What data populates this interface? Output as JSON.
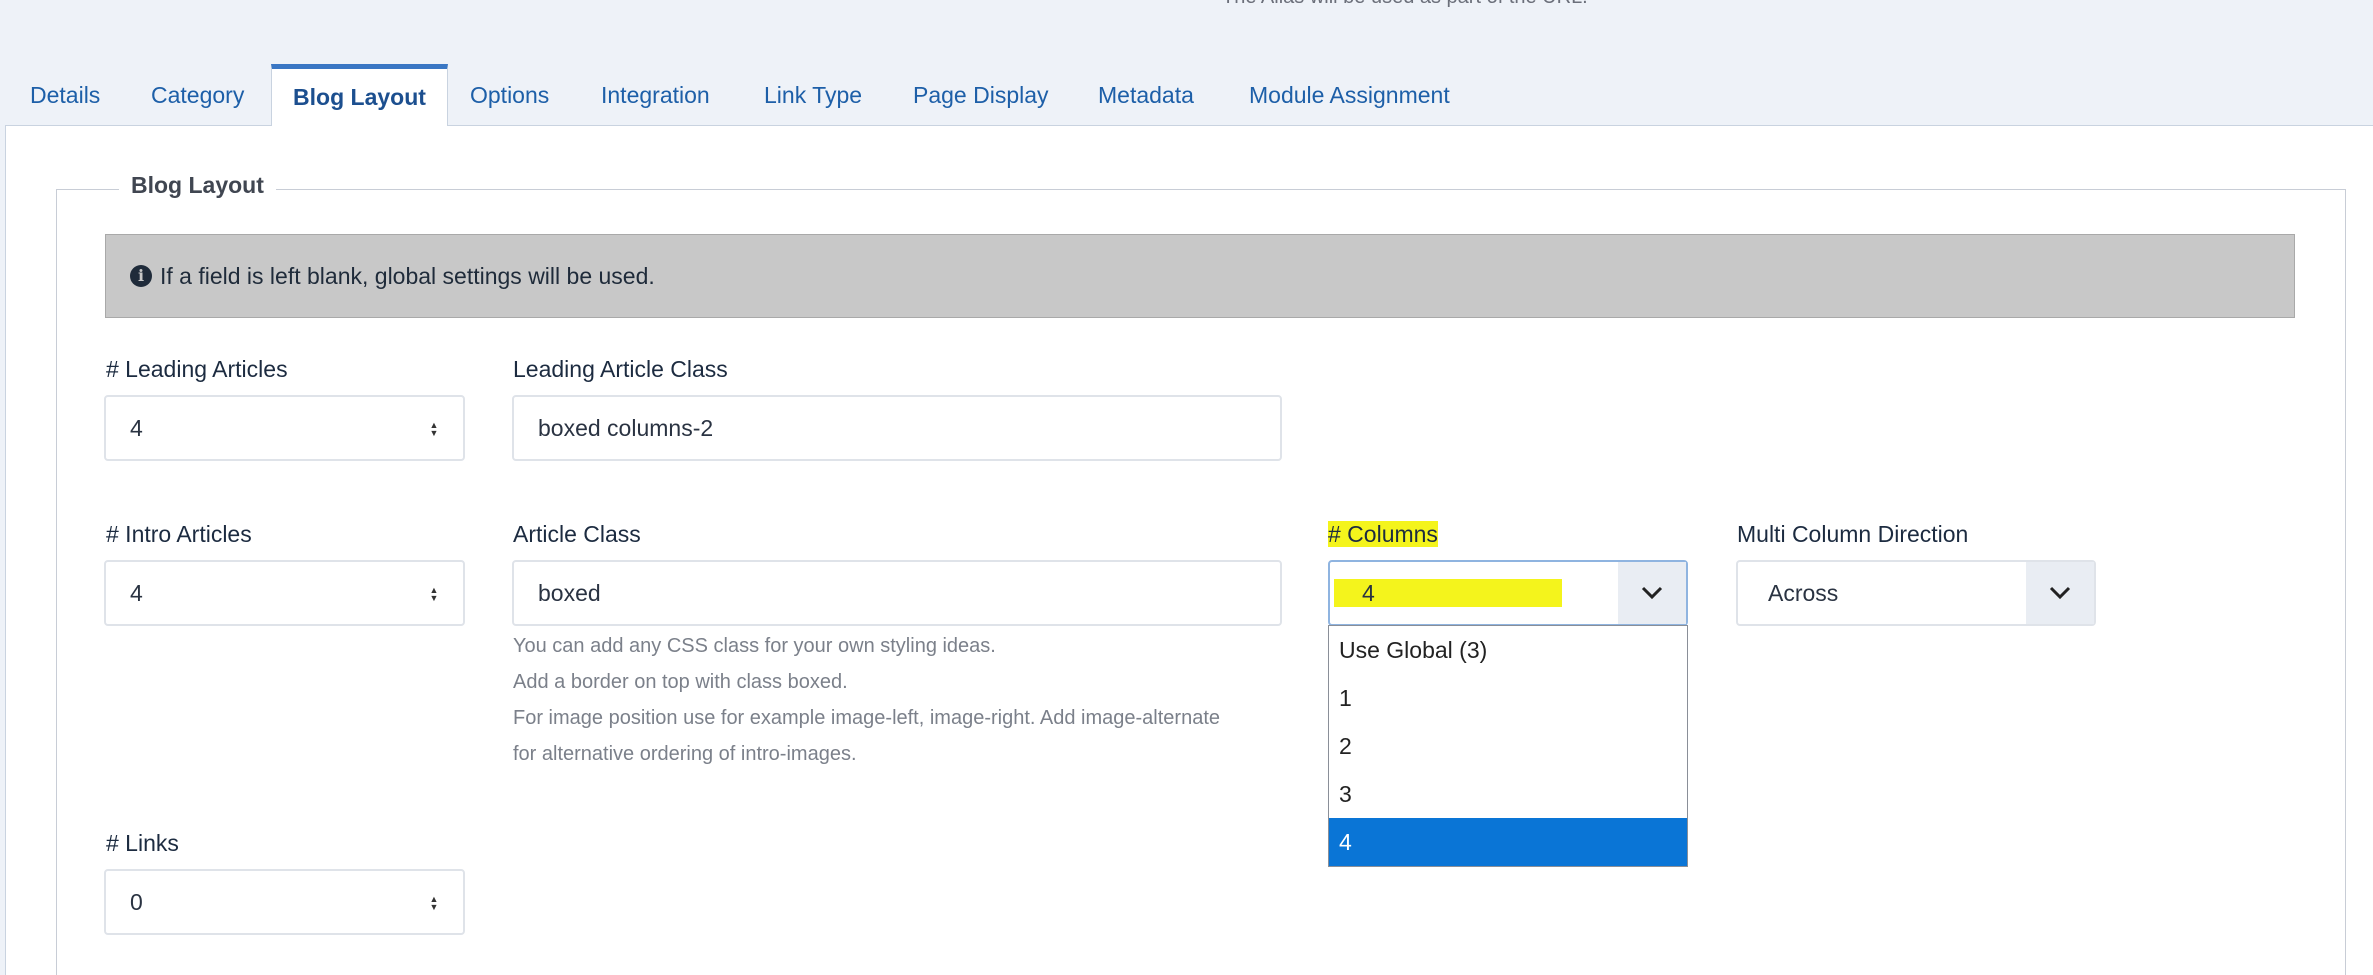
{
  "top_note": "The Alias will be used as part of the URL.",
  "tabs": [
    {
      "label": "Details"
    },
    {
      "label": "Category"
    },
    {
      "label": "Blog Layout"
    },
    {
      "label": "Options"
    },
    {
      "label": "Integration"
    },
    {
      "label": "Link Type"
    },
    {
      "label": "Page Display"
    },
    {
      "label": "Metadata"
    },
    {
      "label": "Module Assignment"
    }
  ],
  "active_tab": "Blog Layout",
  "section": {
    "legend": "Blog Layout",
    "alert_text": "If a field is left blank, global settings will be used."
  },
  "fields": {
    "leading_articles": {
      "label": "# Leading Articles",
      "value": "4"
    },
    "leading_article_class": {
      "label": "Leading Article Class",
      "value": "boxed columns-2"
    },
    "intro_articles": {
      "label": "# Intro Articles",
      "value": "4"
    },
    "article_class": {
      "label": "Article Class",
      "value": "boxed",
      "help": [
        "You can add any CSS class for your own styling ideas.",
        "Add a border on top with class boxed.",
        "For image position use for example image-left, image-right. Add image-alternate",
        "for alternative ordering of intro-images."
      ]
    },
    "columns": {
      "label": "# Columns",
      "value": "4",
      "options": [
        "Use Global (3)",
        "1",
        "2",
        "3",
        "4"
      ],
      "selected_index": 4
    },
    "multi_column_direction": {
      "label": "Multi Column Direction",
      "value": "Across"
    },
    "links": {
      "label": "# Links",
      "value": "0"
    }
  },
  "colors": {
    "tab_text": "#1d5fa8",
    "highlight": "#f4f41c",
    "selected_option": "#0a75d6",
    "alert_bg": "#c8c8c8"
  }
}
